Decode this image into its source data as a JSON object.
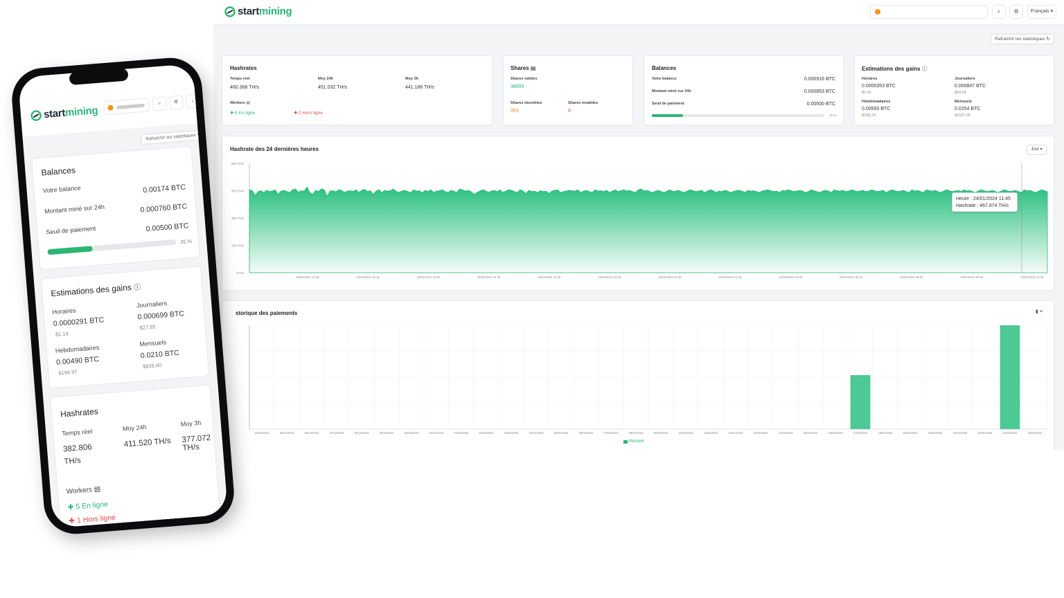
{
  "brand": {
    "name_dark": "start",
    "name_green": "mining",
    "accent": "#2bb673",
    "offline": "#e04b4b",
    "warning": "#e58a2e"
  },
  "header": {
    "language": "Français ▾",
    "search_icon": "search-icon",
    "settings_icon": "gear-icon"
  },
  "refresh_label": "Rafraîchir les statistiques ↻",
  "hashrates": {
    "title": "Hashrates",
    "realtime_label": "Temps réel",
    "realtime_value": "460.368 TH/s",
    "avg24_label": "Moy 24h",
    "avg24_value": "451.032 TH/s",
    "avg3_label": "Moy 3h",
    "avg3_value": "441.186 TH/s",
    "workers_label": "Workers",
    "online": "✚ 6 En ligne",
    "offline": "✚ 0 Hors ligne"
  },
  "shares": {
    "title": "Shares",
    "valid_label": "Shares valides",
    "valid_value": "38895",
    "obsolete_label": "Shares obsolètes",
    "obsolete_value": "353",
    "invalid_label": "Shares invalides",
    "invalid_value": "0"
  },
  "balances": {
    "title": "Balances",
    "balance_label": "Votre balance",
    "balance_value": "0.000916 BTC",
    "mined_label": "Montant miné sur 24h",
    "mined_value": "0.000853 BTC",
    "threshold_label": "Seuil de paiement",
    "threshold_value": "0.00500 BTC",
    "progress_label": "18 %",
    "progress": 18
  },
  "estimations": {
    "title": "Estimations des gains",
    "hourly_label": "Horaires",
    "hourly_btc": "0.0000353 BTC",
    "hourly_usd": "$1.42",
    "daily_label": "Journaliers",
    "daily_btc": "0.000847 BTC",
    "daily_usd": "$34.03",
    "weekly_label": "Hebdomadaires",
    "weekly_btc": "0.00593 BTC",
    "weekly_usd": "$238.24",
    "monthly_label": "Mensuels",
    "monthly_btc": "0.0254 BTC",
    "monthly_usd": "$1021.05"
  },
  "hashrate_chart": {
    "title": "Hashrate des 24 dernières heures",
    "period": "Jour ▾",
    "tooltip_time": "Heure : 24/01/2024 11:45",
    "tooltip_value": "Hashrate : 467.874 TH/s"
  },
  "payments_chart": {
    "title": "storique des paiements",
    "legend": "Montant"
  },
  "chart_data": [
    {
      "type": "area",
      "title": "Hashrate des 24 dernières heures",
      "ylim": [
        0,
        600
      ],
      "yticks": [
        "600 TH/s",
        "450 TH/s",
        "300 TH/s",
        "150 TH/s",
        "0 H/s"
      ],
      "ytick_values": [
        600,
        450,
        300,
        150,
        0
      ],
      "x_labels": [
        "23/01/2024 14:30",
        "23/01/2024 16:15",
        "23/01/2024 18:00",
        "23/01/2024 19:45",
        "23/01/2024 21:30",
        "23/01/2024 23:15",
        "24/01/2024 01:00",
        "24/01/2024 02:45",
        "24/01/2024 04:30",
        "24/01/2024 06:15",
        "24/01/2024 08:00",
        "24/01/2024 09:45",
        "24/01/2024 12:30"
      ],
      "values": [
        455,
        450,
        425,
        445,
        450,
        440,
        452,
        445,
        448,
        455,
        430,
        448,
        452,
        446,
        440,
        455,
        460,
        442,
        450,
        448,
        470,
        440,
        430,
        452,
        445,
        460,
        455,
        420,
        448,
        450,
        444,
        455,
        452,
        440,
        448,
        450,
        446,
        455,
        440,
        452,
        458,
        445,
        450,
        430,
        448,
        455,
        440,
        452,
        448,
        450,
        460,
        445,
        442,
        448,
        452,
        445,
        440,
        455,
        448,
        450,
        438,
        452,
        446,
        455,
        440,
        448,
        450,
        455,
        445,
        440,
        452,
        448,
        440,
        460,
        455,
        448,
        452,
        445,
        430,
        440,
        448,
        455,
        450,
        440,
        448,
        452,
        445,
        455,
        440,
        448,
        455,
        452,
        445,
        440,
        455,
        448,
        435,
        452,
        445,
        448,
        440,
        450,
        445,
        448,
        435,
        448,
        452,
        455,
        440,
        445,
        448,
        452,
        450,
        448,
        455,
        440,
        448,
        452,
        445,
        440,
        455,
        448,
        450,
        445,
        452,
        440,
        448,
        455,
        445,
        450,
        455,
        448,
        452,
        445,
        440,
        455,
        460,
        448,
        452,
        445,
        440,
        448,
        452,
        445,
        440,
        448,
        455,
        445,
        448,
        452,
        445,
        440,
        448,
        455,
        450,
        445,
        448,
        452,
        440,
        448,
        455,
        450,
        440,
        448,
        445,
        452,
        448,
        440,
        445,
        450,
        452,
        448,
        440,
        452,
        448,
        450,
        445,
        440,
        448,
        452,
        455,
        450,
        445,
        448,
        440,
        452,
        448,
        455,
        450,
        445,
        448,
        452,
        448,
        440,
        445,
        455,
        450,
        445,
        440,
        448,
        452,
        448,
        440,
        455,
        450,
        448,
        452,
        445,
        448,
        455,
        450,
        445,
        448,
        452,
        445,
        448,
        455,
        450,
        445,
        448,
        452,
        440,
        448,
        455,
        450,
        445,
        448,
        452,
        445,
        440,
        455,
        448,
        452,
        445,
        440,
        455,
        450,
        448,
        452,
        445,
        440,
        448,
        455,
        450,
        445,
        448,
        452,
        445,
        455,
        448,
        452,
        445,
        440,
        448,
        455,
        450,
        445,
        448,
        452,
        445,
        440,
        448,
        455,
        450,
        445,
        448,
        452,
        445,
        440,
        455,
        448,
        452,
        445,
        440,
        448,
        455,
        450,
        445
      ]
    },
    {
      "type": "bar",
      "title": "storique des paiements",
      "categories": [
        "24/12/2023",
        "25/12/2023",
        "26/12/2023",
        "27/12/2023",
        "28/12/2023",
        "29/12/2023",
        "30/12/2023",
        "31/12/2023",
        "01/01/2024",
        "02/01/2024",
        "03/01/2024",
        "04/01/2024",
        "05/01/2024",
        "06/01/2024",
        "07/01/2024",
        "08/01/2024",
        "09/01/2024",
        "10/01/2024",
        "11/01/2024",
        "12/01/2024",
        "13/01/2024",
        "14/01/2024",
        "15/01/2024",
        "16/01/2024",
        "17/01/2024",
        "18/01/2024",
        "19/01/2024",
        "20/01/2024",
        "21/01/2024",
        "22/01/2024",
        "23/01/2024",
        "24/01/2024"
      ],
      "values": [
        0,
        0,
        0,
        0,
        0,
        0,
        0,
        0,
        0,
        0,
        0,
        0,
        0,
        0,
        0,
        0,
        0,
        0,
        0,
        0,
        0,
        0,
        0,
        0,
        0.0052,
        0,
        0,
        0,
        0,
        0,
        0.01,
        0
      ],
      "ylim": [
        0,
        0.01
      ],
      "legend": [
        "Montant"
      ]
    }
  ],
  "phone": {
    "refresh_label": "Rafraîchir les statistiques ↻",
    "balances": {
      "title": "Balances",
      "balance_label": "Votre balance",
      "balance_value": "0.00174 BTC",
      "mined_label": "Montant miné sur 24h",
      "mined_value": "0.000760 BTC",
      "threshold_label": "Seuil de paiement",
      "threshold_value": "0.00500 BTC",
      "progress_label": "35 %",
      "progress": 35
    },
    "estimations": {
      "title": "Estimations des gains",
      "hourly_label": "Horaires",
      "hourly_btc": "0.0000291 BTC",
      "hourly_usd": "$1.16",
      "daily_label": "Journaliers",
      "daily_btc": "0.000699 BTC",
      "daily_usd": "$27.85",
      "weekly_label": "Hebdomadaires",
      "weekly_btc": "0.00490 BTC",
      "weekly_usd": "$194.97",
      "monthly_label": "Mensuels",
      "monthly_btc": "0.0210 BTC",
      "monthly_usd": "$835.60"
    },
    "hashrates": {
      "title": "Hashrates",
      "realtime_label": "Temps réel",
      "realtime_value": "382.806",
      "realtime_unit": "TH/s",
      "avg24_label": "Moy 24h",
      "avg24_value": "411.520 TH/s",
      "avg3_label": "Moy 3h",
      "avg3_value": "377.072 TH/s",
      "workers_label": "Workers",
      "online": "5 En ligne",
      "offline": "1 Hors ligne"
    }
  }
}
